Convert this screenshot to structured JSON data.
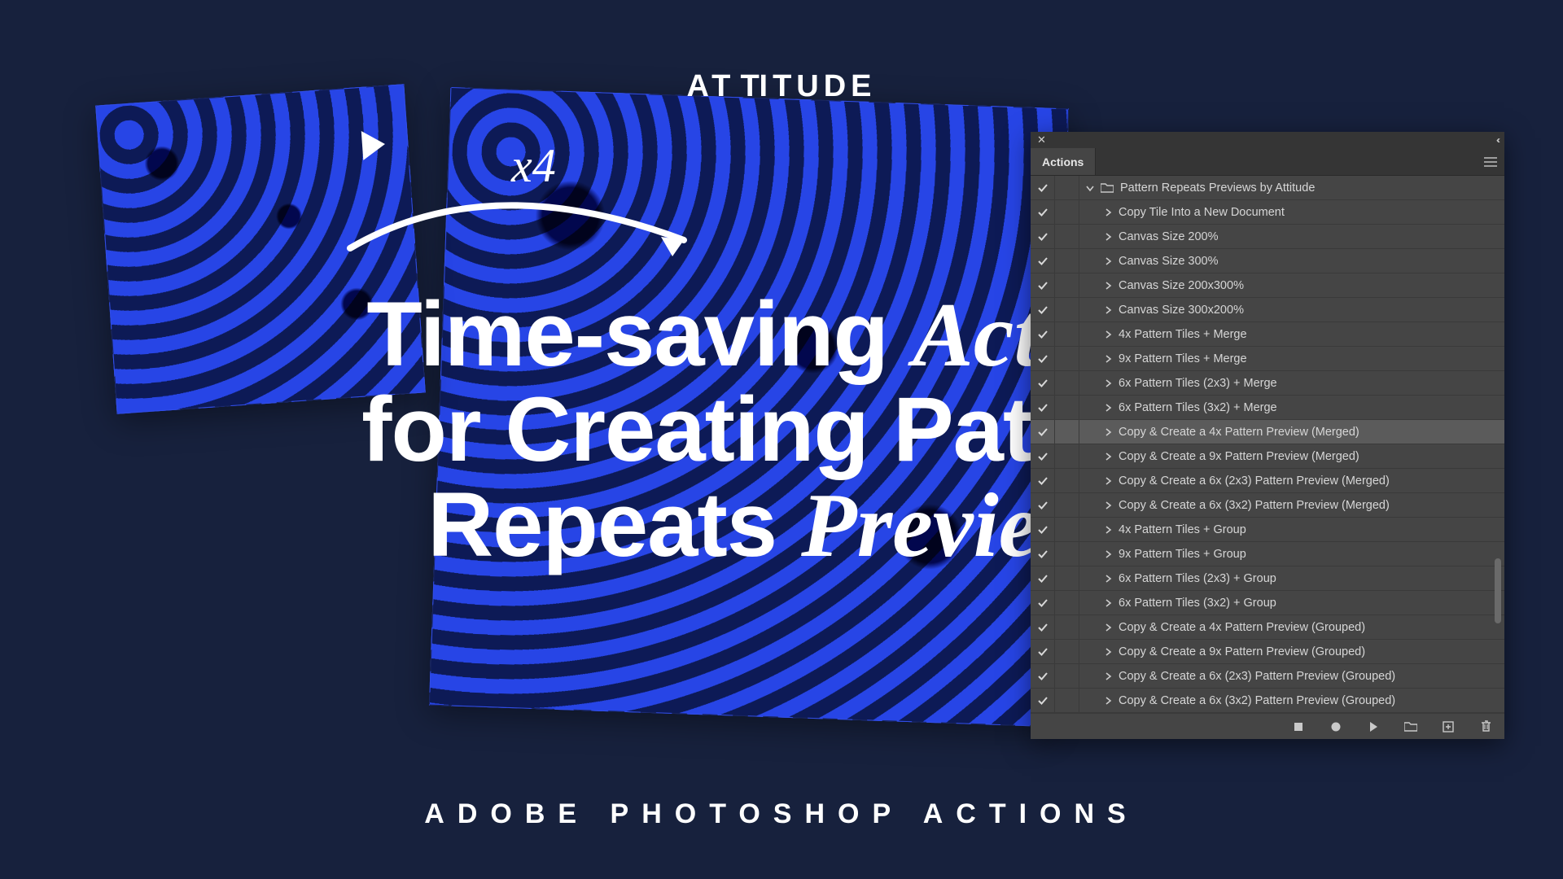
{
  "brand": "ATTITUDE",
  "scale_label": "x4",
  "headline_parts": {
    "p1": "Time-saving ",
    "p2_em": "Actions",
    "p3": "for Creating Pattern",
    "p4": "Repeats ",
    "p5_em": "Previews"
  },
  "subtitle": "ADOBE PHOTOSHOP ACTIONS",
  "panel": {
    "tab_label": "Actions",
    "set_name": "Pattern Repeats Previews by Attitude",
    "actions": [
      {
        "label": "Copy Tile Into a New Document"
      },
      {
        "label": "Canvas Size 200%"
      },
      {
        "label": "Canvas Size 300%"
      },
      {
        "label": "Canvas Size 200x300%"
      },
      {
        "label": "Canvas Size 300x200%"
      },
      {
        "label": "4x Pattern Tiles + Merge"
      },
      {
        "label": "9x Pattern Tiles + Merge"
      },
      {
        "label": "6x Pattern Tiles (2x3) + Merge"
      },
      {
        "label": "6x Pattern Tiles (3x2) + Merge"
      },
      {
        "label": "Copy & Create a 4x Pattern Preview (Merged)",
        "selected": true
      },
      {
        "label": "Copy & Create a 9x Pattern Preview (Merged)"
      },
      {
        "label": "Copy & Create a 6x (2x3) Pattern Preview (Merged)"
      },
      {
        "label": "Copy & Create a 6x (3x2) Pattern Preview (Merged)"
      },
      {
        "label": "4x Pattern Tiles + Group"
      },
      {
        "label": "9x Pattern Tiles + Group"
      },
      {
        "label": "6x Pattern Tiles (2x3) + Group"
      },
      {
        "label": "6x Pattern Tiles (3x2) + Group"
      },
      {
        "label": "Copy & Create a 4x Pattern Preview (Grouped)"
      },
      {
        "label": "Copy & Create a 9x Pattern Preview (Grouped)"
      },
      {
        "label": "Copy & Create a 6x (2x3) Pattern Preview (Grouped)"
      },
      {
        "label": "Copy & Create a 6x (3x2) Pattern Preview (Grouped)"
      }
    ]
  }
}
